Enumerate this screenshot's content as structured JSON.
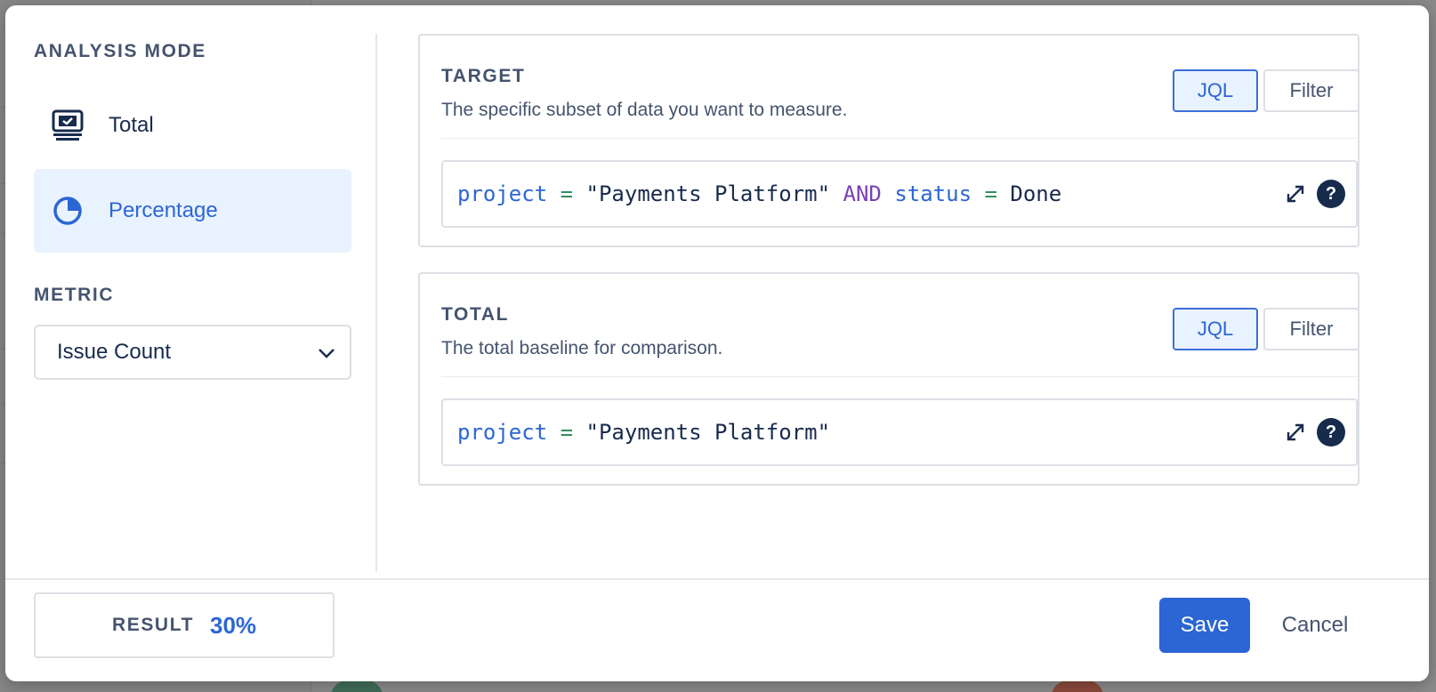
{
  "sidebar": {
    "analysis_mode_label": "ANALYSIS MODE",
    "modes": [
      {
        "label": "Total",
        "icon": "monitor-check-icon",
        "selected": false
      },
      {
        "label": "Percentage",
        "icon": "pie-chart-icon",
        "selected": true
      }
    ],
    "metric_label": "METRIC",
    "metric_selected": "Issue Count"
  },
  "target": {
    "title": "TARGET",
    "description": "The specific subset of data you want to measure.",
    "toggle_jql": "JQL",
    "toggle_filter": "Filter",
    "query": {
      "field1": "project",
      "op1": "=",
      "value1": "\"Payments Platform\"",
      "keyword": "AND",
      "field2": "status",
      "op2": "=",
      "value2": "Done"
    }
  },
  "total": {
    "title": "TOTAL",
    "description": "The total baseline for comparison.",
    "toggle_jql": "JQL",
    "toggle_filter": "Filter",
    "query": {
      "field1": "project",
      "op1": "=",
      "value1": "\"Payments Platform\""
    }
  },
  "footer": {
    "result_label": "RESULT",
    "result_value": "30%",
    "save_label": "Save",
    "cancel_label": "Cancel"
  },
  "colors": {
    "accent": "#2c66d4",
    "selected_bg": "#e9f2ff",
    "keyword": "#7a3fb3",
    "operator": "#2f8f5b"
  }
}
